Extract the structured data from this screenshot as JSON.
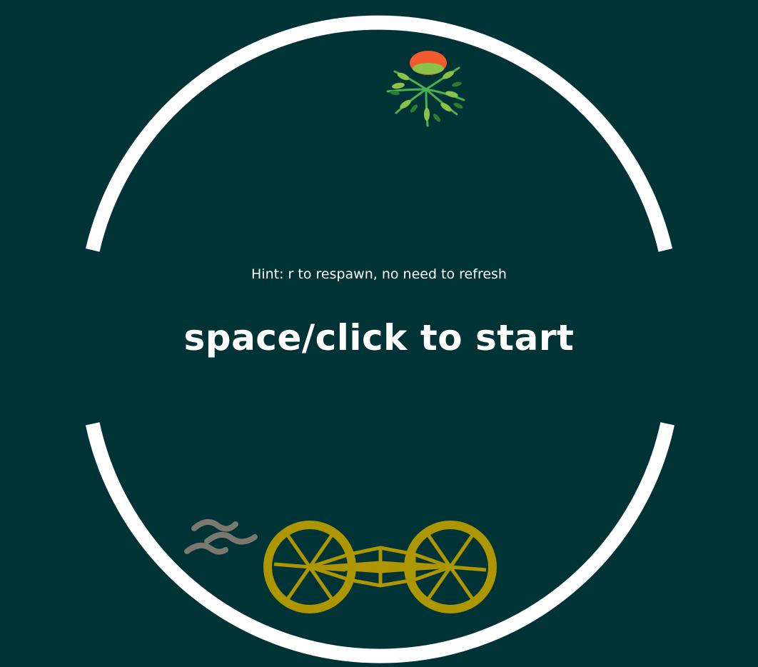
{
  "game": {
    "hint": "Hint: r to respawn, no need to refresh",
    "start_prompt": "space/click to start"
  },
  "colors": {
    "background": "#003335",
    "track": "#ffffff",
    "bike": "#ad9600",
    "exhaust": "#7a786f",
    "flower_petal": "#ef5a2e",
    "leaf_light": "#8bc34a",
    "leaf_dark": "#2e7d32"
  },
  "icons": {
    "player": "bicycle-icon",
    "pickup": "flower-icon",
    "exhaust": "speed-lines-icon"
  }
}
